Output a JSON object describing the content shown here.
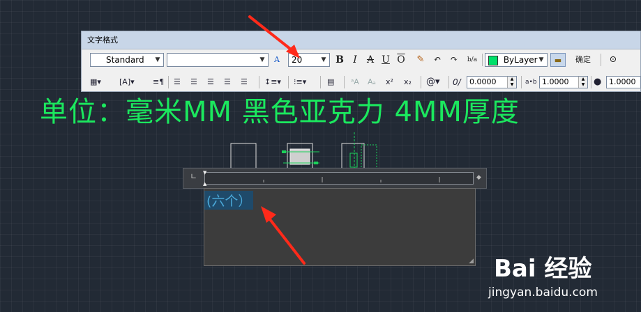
{
  "toolbar": {
    "title": "文字格式",
    "style": "Standard",
    "font": "",
    "height": "20",
    "bold": "B",
    "italic": "I",
    "strike": "A",
    "underline": "U",
    "overline": "O",
    "undo": "↶",
    "redo": "↷",
    "stack": "b/a",
    "color": "ByLayer",
    "color_swatch": "#00e06a",
    "ok": "确定",
    "oblique": "0.0000",
    "tracking": "1.0000",
    "width": "1.0000",
    "at_symbol": "@"
  },
  "canvas": {
    "big_text": "单位：毫米MM 黑色亚克力 4MM厚度",
    "editor_text": "(六个）"
  },
  "watermark": {
    "logo": "Bai 经验",
    "url": "jingyan.baidu.com"
  }
}
